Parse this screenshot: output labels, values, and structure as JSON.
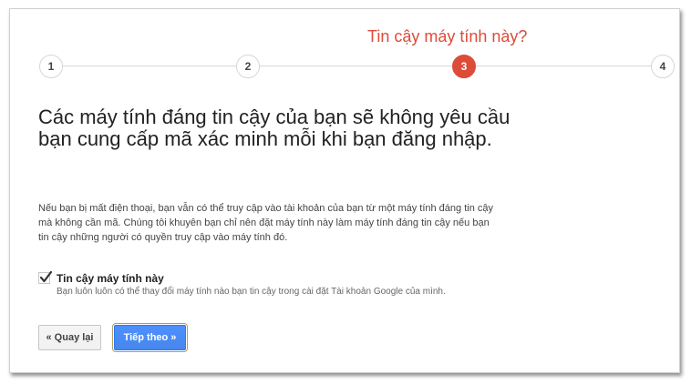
{
  "stepper": {
    "current_title": "Tin cậy máy tính này?",
    "steps": [
      "1",
      "2",
      "3",
      "4"
    ],
    "active_step": 3,
    "active_color": "#dd4b39"
  },
  "main": {
    "heading": "Các máy tính đáng tin cậy của bạn sẽ không yêu cầu bạn cung cấp mã xác minh mỗi khi bạn đăng nhập.",
    "description": "Nếu bạn bị mất điện thoại, bạn vẫn có thể truy cập vào tài khoản của bạn từ một máy tính đáng tin cậy mà không cần mã. Chúng tôi khuyên bạn chỉ nên đặt máy tính này làm máy tính đáng tin cậy nếu bạn tin cậy những người có quyền truy cập vào máy tính đó."
  },
  "trust_checkbox": {
    "checked": true,
    "label": "Tin cậy máy tính này",
    "hint": "Bạn luôn luôn có thể thay đổi máy tính nào bạn tin cậy trong cài đặt Tài khoản Google của mình."
  },
  "buttons": {
    "back_label": "« Quay lại",
    "next_label": "Tiếp theo »",
    "next_color": "#4d90fe"
  }
}
